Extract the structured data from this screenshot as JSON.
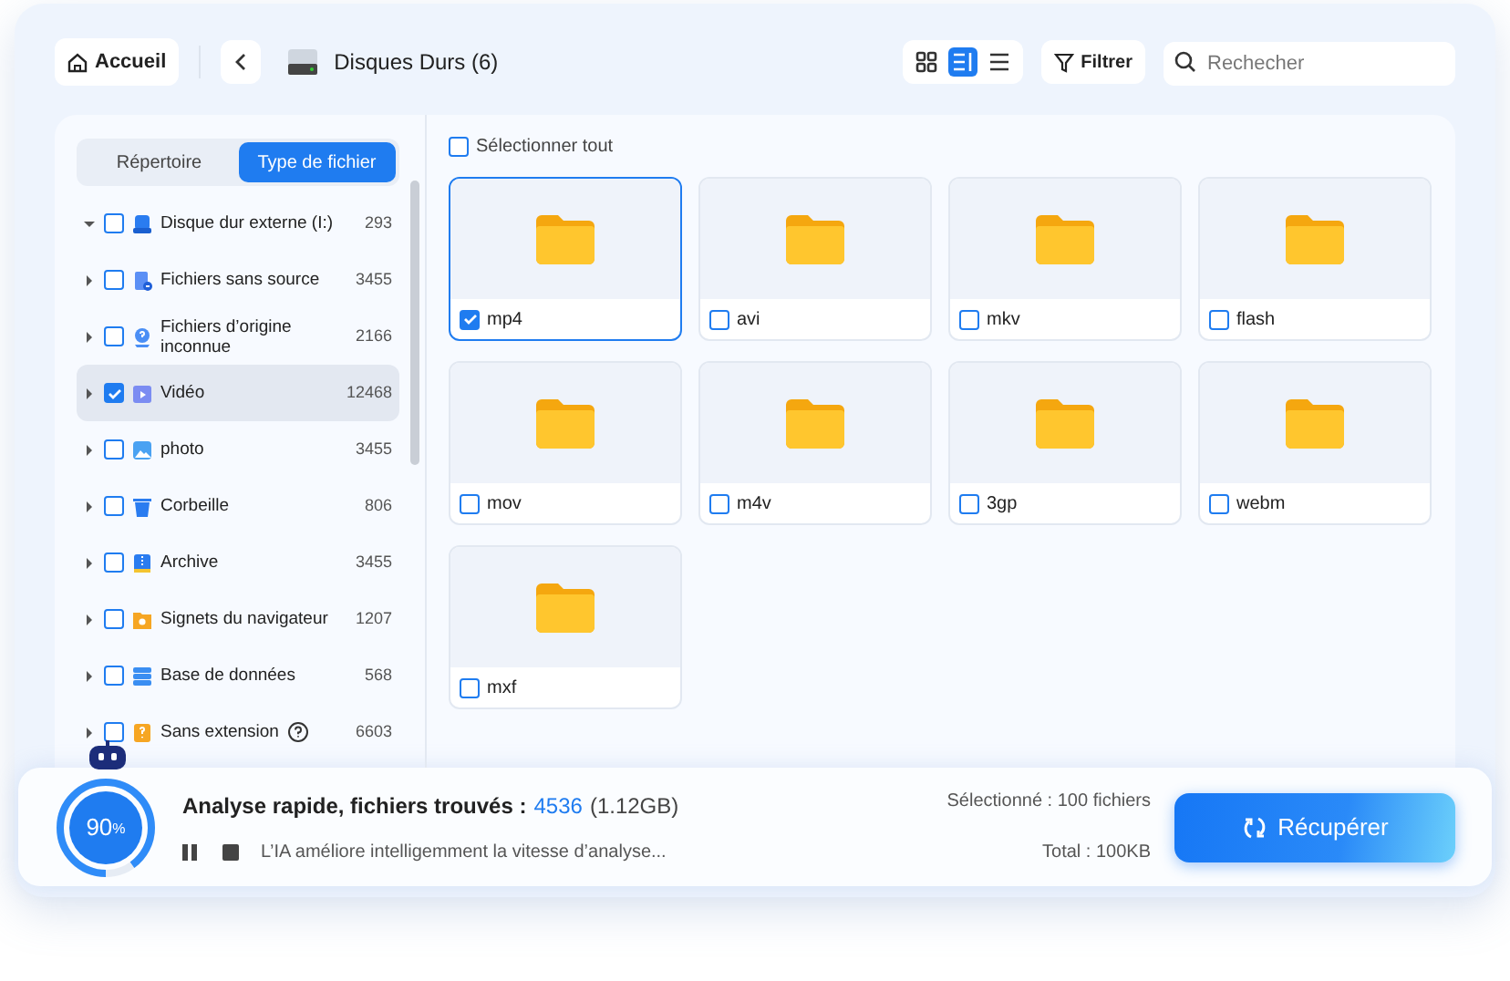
{
  "header": {
    "home_button": "Accueil",
    "title": "Disques Durs (6)",
    "view_modes": [
      {
        "kind": "grid",
        "selected": false
      },
      {
        "kind": "detail",
        "selected": true
      },
      {
        "kind": "list",
        "selected": false
      }
    ],
    "filter_button": "Filtrer",
    "search": {
      "placeholder": "Rechecher"
    }
  },
  "sidebar": {
    "tabs": [
      {
        "label": "Répertoire",
        "selected": false
      },
      {
        "label": "Type de fichier",
        "selected": true
      }
    ],
    "items": [
      {
        "kind": "drive",
        "label": "Disque dur externe (I:)",
        "count": "293",
        "expanded": true,
        "checked": false,
        "selected": false
      },
      {
        "kind": "nosource",
        "label": "Fichiers sans source",
        "count": "3455",
        "expanded": false,
        "checked": false,
        "selected": false
      },
      {
        "kind": "unknown",
        "label": "Fichiers d’origine inconnue",
        "count": "2166",
        "expanded": false,
        "checked": false,
        "selected": false
      },
      {
        "kind": "video",
        "label": "Vidéo",
        "count": "12468",
        "expanded": false,
        "checked": true,
        "selected": true
      },
      {
        "kind": "photo",
        "label": "photo",
        "count": "3455",
        "expanded": false,
        "checked": false,
        "selected": false
      },
      {
        "kind": "trash",
        "label": "Corbeille",
        "count": "806",
        "expanded": false,
        "checked": false,
        "selected": false
      },
      {
        "kind": "archive",
        "label": "Archive",
        "count": "3455",
        "expanded": false,
        "checked": false,
        "selected": false
      },
      {
        "kind": "bookmark",
        "label": "Signets du navigateur",
        "count": "1207",
        "expanded": false,
        "checked": false,
        "selected": false
      },
      {
        "kind": "database",
        "label": "Base de données",
        "count": "568",
        "expanded": false,
        "checked": false,
        "selected": false
      },
      {
        "kind": "noext",
        "label": "Sans extension",
        "count": "6603",
        "expanded": false,
        "checked": false,
        "selected": false,
        "help": true
      }
    ]
  },
  "content": {
    "select_all": {
      "label": "Sélectionner tout",
      "checked": false
    },
    "folders": [
      {
        "name": "mp4",
        "checked": true,
        "selected": true
      },
      {
        "name": "avi",
        "checked": false,
        "selected": false
      },
      {
        "name": "mkv",
        "checked": false,
        "selected": false
      },
      {
        "name": "flash",
        "checked": false,
        "selected": false
      },
      {
        "name": "mov",
        "checked": false,
        "selected": false
      },
      {
        "name": "m4v",
        "checked": false,
        "selected": false
      },
      {
        "name": "3gp",
        "checked": false,
        "selected": false
      },
      {
        "name": "webm",
        "checked": false,
        "selected": false
      },
      {
        "name": "mxf",
        "checked": false,
        "selected": false
      }
    ]
  },
  "status": {
    "progress": {
      "level": 0.9,
      "reading": "90",
      "unit": "%"
    },
    "title": "Analyse rapide, fichiers trouvés :",
    "found": "4536",
    "size": "(1.12GB)",
    "message": "L’IA améliore intelligemment la vitesse d’analyse...",
    "selected": "Sélectionné : 100 fichiers",
    "total": "Total : 100KB",
    "recover_button": "Récupérer"
  }
}
